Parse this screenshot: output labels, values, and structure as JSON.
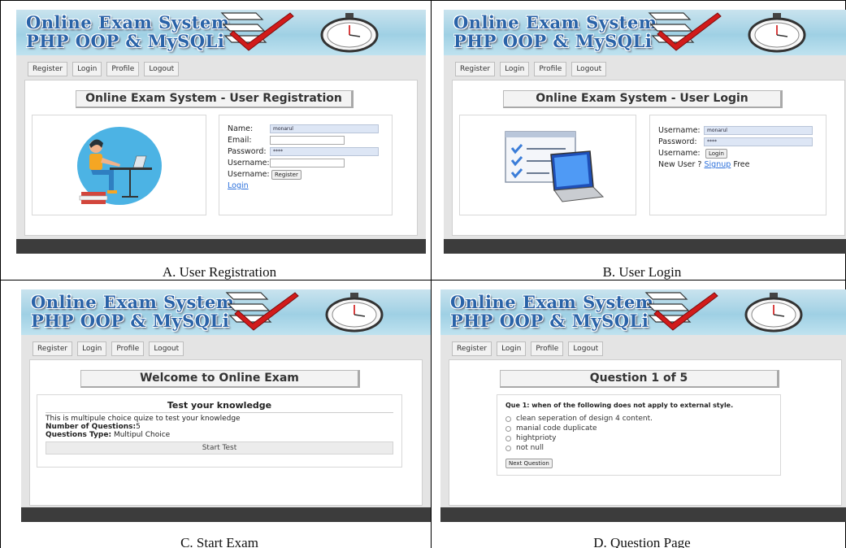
{
  "banner": {
    "line1": "Online Exam System",
    "line2": "PHP OOP & MySQLi"
  },
  "nav": [
    "Register",
    "Login",
    "Profile",
    "Logout"
  ],
  "panels": {
    "a": {
      "heading": "Online Exam System - User Registration",
      "name_label": "Name:",
      "name_value": "monarul",
      "email_label": "Email:",
      "email_value": "",
      "password_label": "Password:",
      "password_value": "****",
      "username_label": "Username:",
      "username_value": "",
      "username2_label": "Username:",
      "register_btn": "Register",
      "login_link": "Login",
      "caption": "A.   User Registration"
    },
    "b": {
      "heading": "Online Exam System - User Login",
      "username_label": "Username:",
      "username_value": "monarul",
      "password_label": "Password:",
      "password_value": "****",
      "username2_label": "Username:",
      "login_btn": "Login",
      "new_user_prefix": "New User ?",
      "signup_link": "Signup",
      "new_user_suffix": "Free",
      "caption": "B.   User Login"
    },
    "c": {
      "heading": "Welcome to Online Exam",
      "sub_heading": "Test your knowledge",
      "description": "This is multipule choice quize to test your knowledge",
      "num_label": "Number of Questions:",
      "num_value": "5",
      "type_label": "Questions Type:",
      "type_value": "Multipul Choice",
      "start_btn": "Start Test",
      "caption": "C.    Start Exam"
    },
    "d": {
      "heading": "Question 1 of 5",
      "question": "Que 1: when of the following does not apply to external style.",
      "options": [
        "clean seperation of design 4 content.",
        "manial code duplicate",
        "hightprioty",
        "not null"
      ],
      "next_btn": "Next Question",
      "caption": "D.   Question Page"
    }
  },
  "colors": {
    "accent_blue": "#2a63a8",
    "field_fill": "#dde6f5",
    "footer": "#3c3c3c",
    "check_red": "#d11b1b"
  },
  "icons": [
    "checklist-banner-icon",
    "checkmark-icon",
    "stopwatch-icon",
    "student-illustration-icon",
    "laptop-checklist-icon"
  ]
}
